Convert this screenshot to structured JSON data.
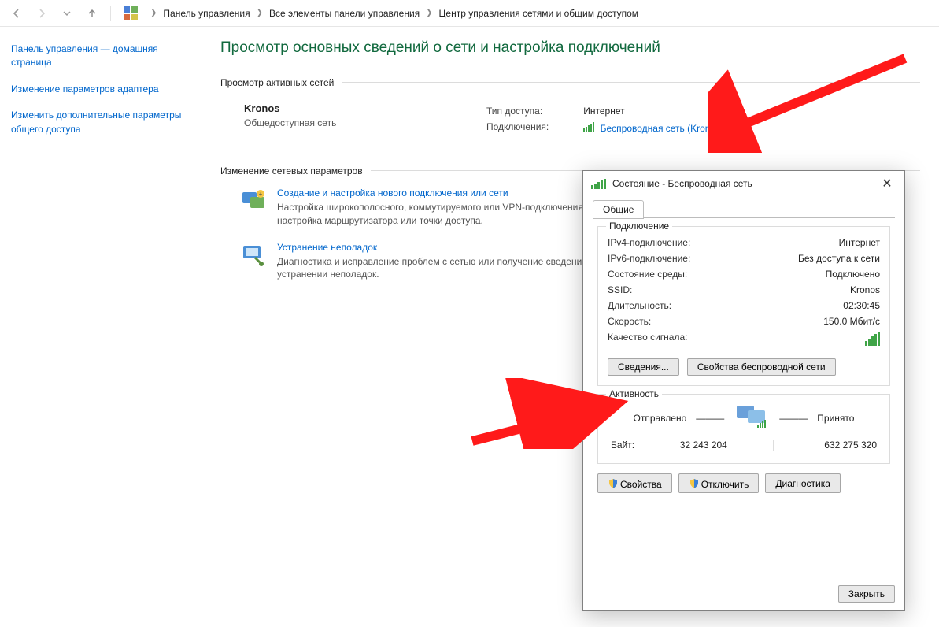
{
  "breadcrumb": {
    "items": [
      "Панель управления",
      "Все элементы панели управления",
      "Центр управления сетями и общим доступом"
    ]
  },
  "sidebar": {
    "links": [
      "Панель управления — домашняя страница",
      "Изменение параметров адаптера",
      "Изменить дополнительные параметры общего доступа"
    ]
  },
  "main": {
    "title": "Просмотр основных сведений о сети и настройка подключений",
    "active_networks_label": "Просмотр активных сетей",
    "network": {
      "name": "Kronos",
      "type": "Общедоступная сеть",
      "access_label": "Тип доступа:",
      "access_value": "Интернет",
      "conn_label": "Подключения:",
      "conn_link": "Беспроводная сеть (Kronos)"
    },
    "change_settings_label": "Изменение сетевых параметров",
    "items": [
      {
        "link": "Создание и настройка нового подключения или сети",
        "desc": "Настройка широкополосного, коммутируемого или VPN-подключения либо настройка маршрутизатора или точки доступа."
      },
      {
        "link": "Устранение неполадок",
        "desc": "Диагностика и исправление проблем с сетью или получение сведений об устранении неполадок."
      }
    ]
  },
  "dialog": {
    "title": "Состояние - Беспроводная сеть",
    "tab": "Общие",
    "connection": {
      "legend": "Подключение",
      "rows": [
        {
          "k": "IPv4-подключение:",
          "v": "Интернет"
        },
        {
          "k": "IPv6-подключение:",
          "v": "Без доступа к сети"
        },
        {
          "k": "Состояние среды:",
          "v": "Подключено"
        },
        {
          "k": "SSID:",
          "v": "Kronos"
        },
        {
          "k": "Длительность:",
          "v": "02:30:45"
        },
        {
          "k": "Скорость:",
          "v": "150.0 Мбит/с"
        }
      ],
      "signal_label": "Качество сигнала:",
      "btn_details": "Сведения...",
      "btn_wprops": "Свойства беспроводной сети"
    },
    "activity": {
      "legend": "Активность",
      "sent_label": "Отправлено",
      "recv_label": "Принято",
      "bytes_label": "Байт:",
      "sent_bytes": "32 243 204",
      "recv_bytes": "632 275 320"
    },
    "footer_buttons": {
      "props": "Свойства",
      "disable": "Отключить",
      "diag": "Диагностика"
    },
    "close_btn": "Закрыть"
  }
}
